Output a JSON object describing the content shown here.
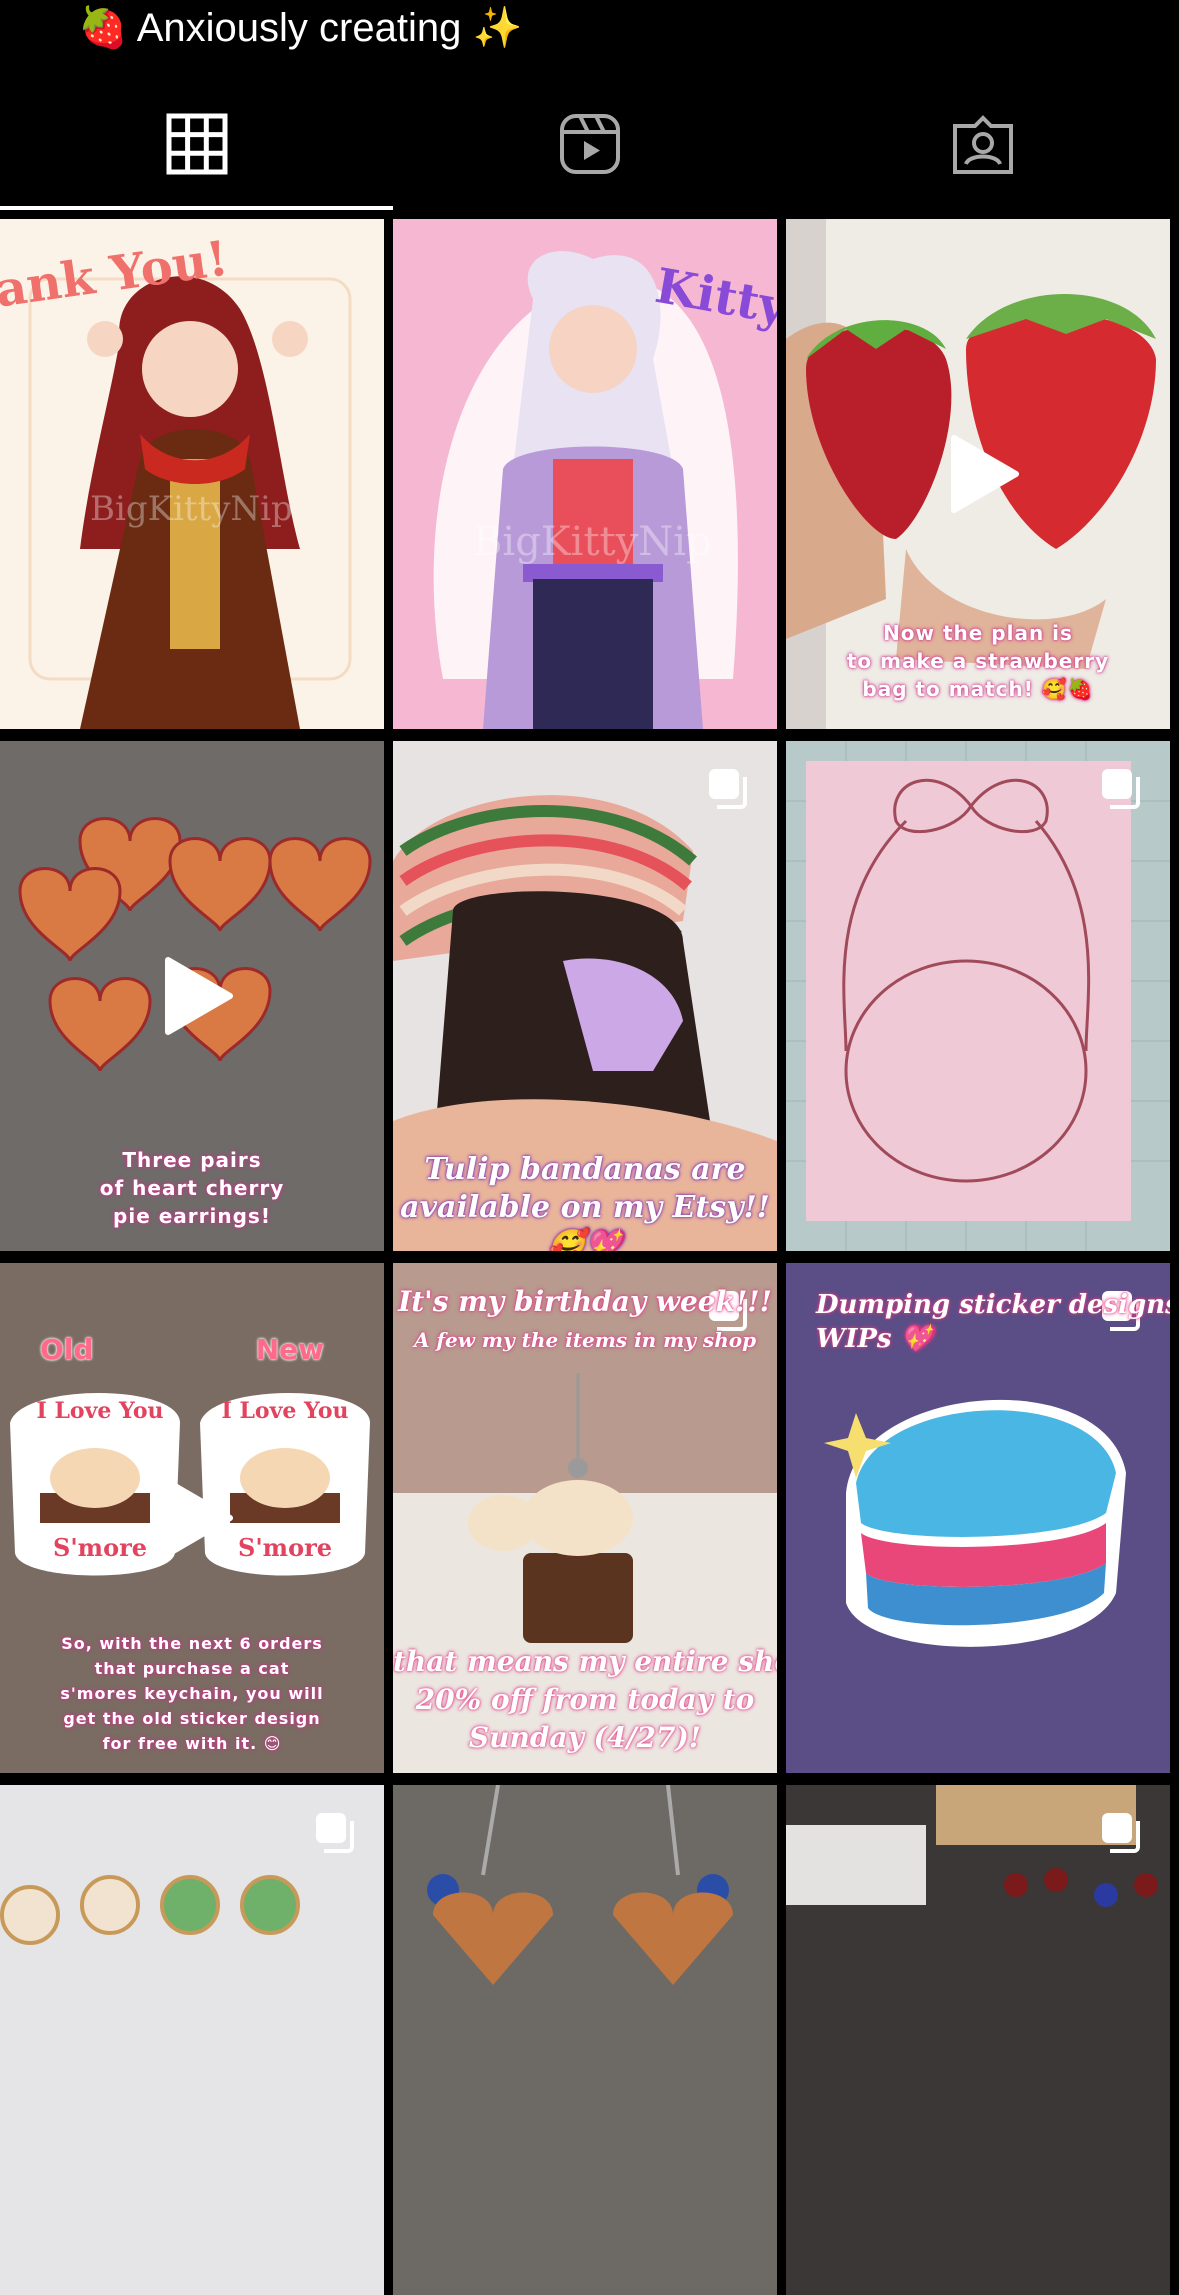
{
  "profile": {
    "bio_emoji_start": "🍓",
    "bio_text": "Anxiously creating",
    "bio_emoji_end": "✨"
  },
  "tabs": [
    {
      "name": "grid-icon",
      "active": true
    },
    {
      "name": "reels-icon",
      "active": false
    },
    {
      "name": "tagged-icon",
      "active": false
    }
  ],
  "posts": [
    {
      "id": 1,
      "type": "image",
      "description": "Illustration: girl with red hair and scarf",
      "text": "hank You!",
      "watermark": "BigKittyNip"
    },
    {
      "id": 2,
      "type": "image",
      "description": "Illustration: cat-eared girl with lavender hair",
      "text": "Kitty",
      "watermark": "BigKittyNip"
    },
    {
      "id": 3,
      "type": "reel",
      "caption_lines": [
        "Now the plan is",
        "to make a strawberry",
        "bag to match! 🥰🍓"
      ]
    },
    {
      "id": 4,
      "type": "reel",
      "caption_lines": [
        "Three pairs",
        "of heart cherry",
        "pie earrings!"
      ]
    },
    {
      "id": 5,
      "type": "carousel",
      "caption_lines": [
        "Tulip bandanas are",
        "available on my Etsy!! 🥰💖"
      ]
    },
    {
      "id": 6,
      "type": "carousel",
      "description": "Pink bow frame sketch on grid mat"
    },
    {
      "id": 7,
      "type": "reel",
      "labels": [
        "Old",
        "New"
      ],
      "sticker_text": [
        "I Love You",
        "S'more"
      ],
      "caption_lines": [
        "So, with the next 6 orders",
        "that purchase a cat",
        "s'mores keychain, you will",
        "get the old sticker design",
        "for free with it. 😊"
      ]
    },
    {
      "id": 8,
      "type": "carousel",
      "caption_top": [
        "It's my birthday week!!!",
        "A few my the items in my shop"
      ],
      "caption_lines": [
        "that means my entire shop is",
        "20% off from today to",
        "Sunday (4/27)!"
      ]
    },
    {
      "id": 9,
      "type": "carousel",
      "caption_lines": [
        "Dumping sticker designs",
        "WIPs 💖"
      ]
    },
    {
      "id": 10,
      "type": "carousel",
      "description": "Painted badges"
    },
    {
      "id": 11,
      "type": "image",
      "description": "Heart pie keychains"
    },
    {
      "id": 12,
      "type": "carousel",
      "description": "Bead organizer and pins"
    }
  ],
  "colors": {
    "background": "#000000",
    "active_tab_indicator": "#ffffff",
    "inactive_icon": "#a8a8a8"
  }
}
